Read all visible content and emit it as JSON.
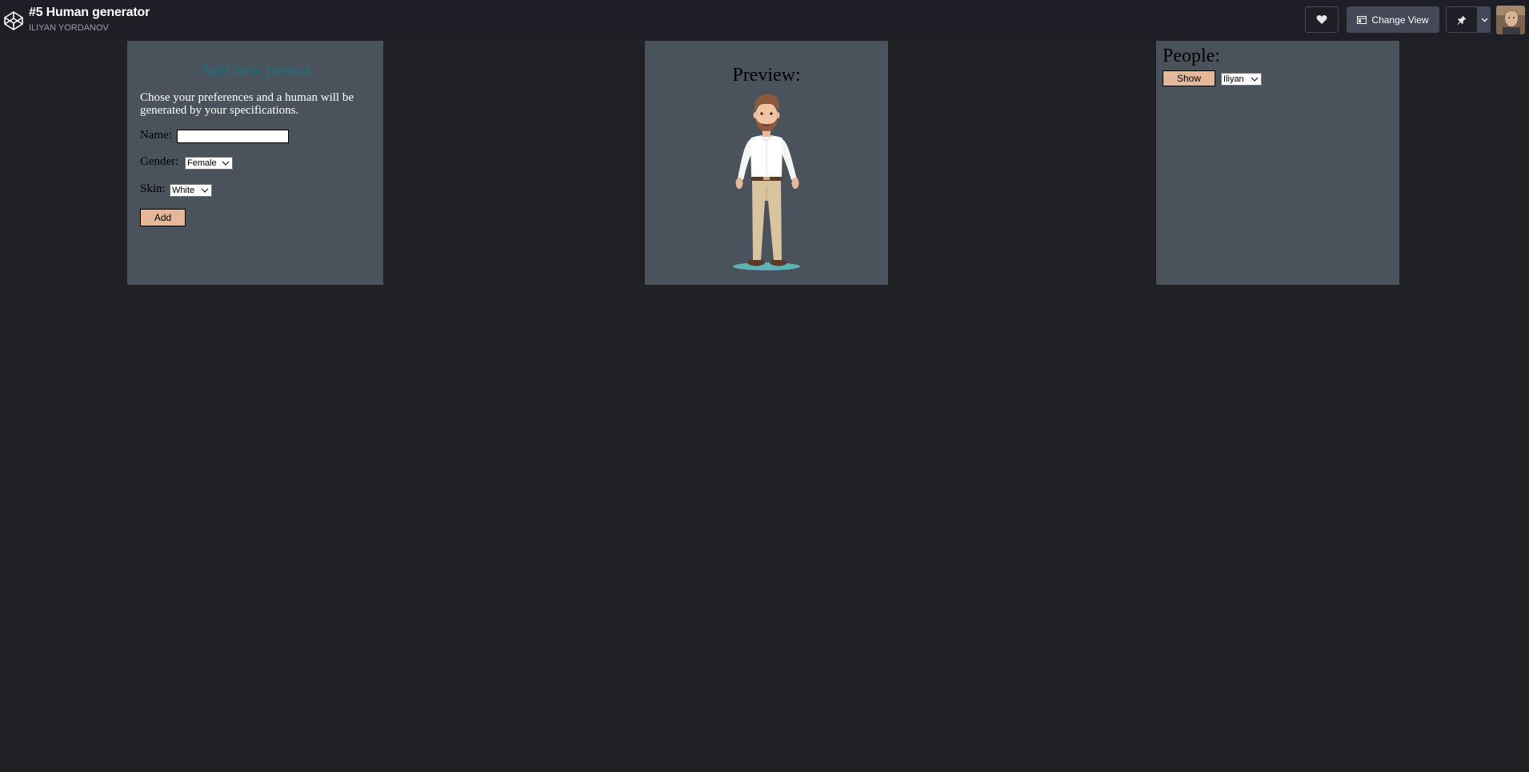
{
  "topbar": {
    "title": "#5 Human generator",
    "author": "ILIYAN YORDANOV",
    "change_view_label": "Change View"
  },
  "add_panel": {
    "heading": "Add new person",
    "description": "Chose your preferences and a human will be generated by your specifications.",
    "name_label": "Name:",
    "name_value": "",
    "gender_label": "Gender:",
    "gender_selected": "Female",
    "skin_label": "Skin:",
    "skin_selected": "White",
    "add_button": "Add"
  },
  "preview_panel": {
    "heading": "Preview:"
  },
  "people_panel": {
    "heading": "People:",
    "show_button": "Show",
    "person_selected": "Iliyan"
  },
  "colors": {
    "page_bg": "#202125",
    "topbar_bg": "#1e1f26",
    "panel_bg": "#4a525c",
    "button_bg": "#e5b89a",
    "heading_teal": "#1f6f7a"
  },
  "icons": [
    "codepen-logo-icon",
    "heart-icon",
    "change-view-icon",
    "pin-icon",
    "chevron-down-icon",
    "avatar"
  ]
}
